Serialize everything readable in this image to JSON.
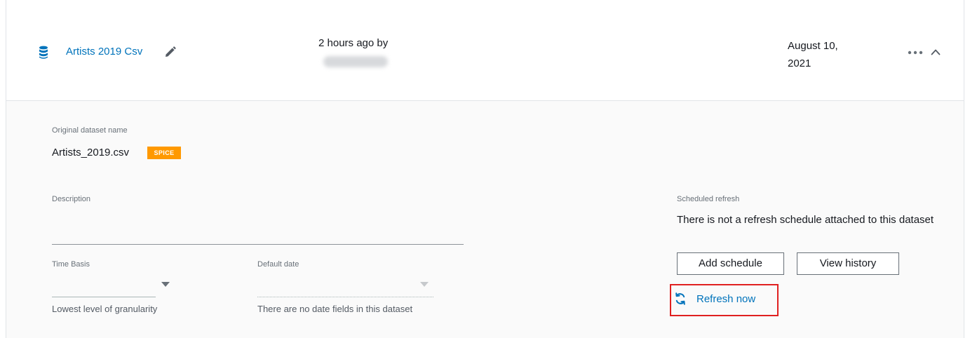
{
  "dataset": {
    "icon": "database-icon",
    "name": "Artists 2019 Csv",
    "edit_icon": "pencil-icon",
    "last_modified": "2 hours ago by",
    "created": "August 10, 2021",
    "more_icon": "ellipsis-icon",
    "collapse_icon": "chevron-up-icon"
  },
  "details": {
    "original_name_label": "Original dataset name",
    "original_name": "Artists_2019.csv",
    "storage_badge": "SPICE",
    "description_label": "Description",
    "description_value": "",
    "time_basis_label": "Time Basis",
    "time_basis_help": "Lowest level of granularity",
    "default_date_label": "Default date",
    "default_date_help": "There are no date fields in this dataset"
  },
  "refresh": {
    "label": "Scheduled refresh",
    "status": "There is not a refresh schedule attached to this dataset",
    "add_schedule": "Add schedule",
    "view_history": "View history",
    "refresh_now": "Refresh now",
    "refresh_icon": "refresh-icon"
  },
  "colors": {
    "link": "#0073bb",
    "badge": "#ff9900",
    "highlight": "#e02020"
  }
}
